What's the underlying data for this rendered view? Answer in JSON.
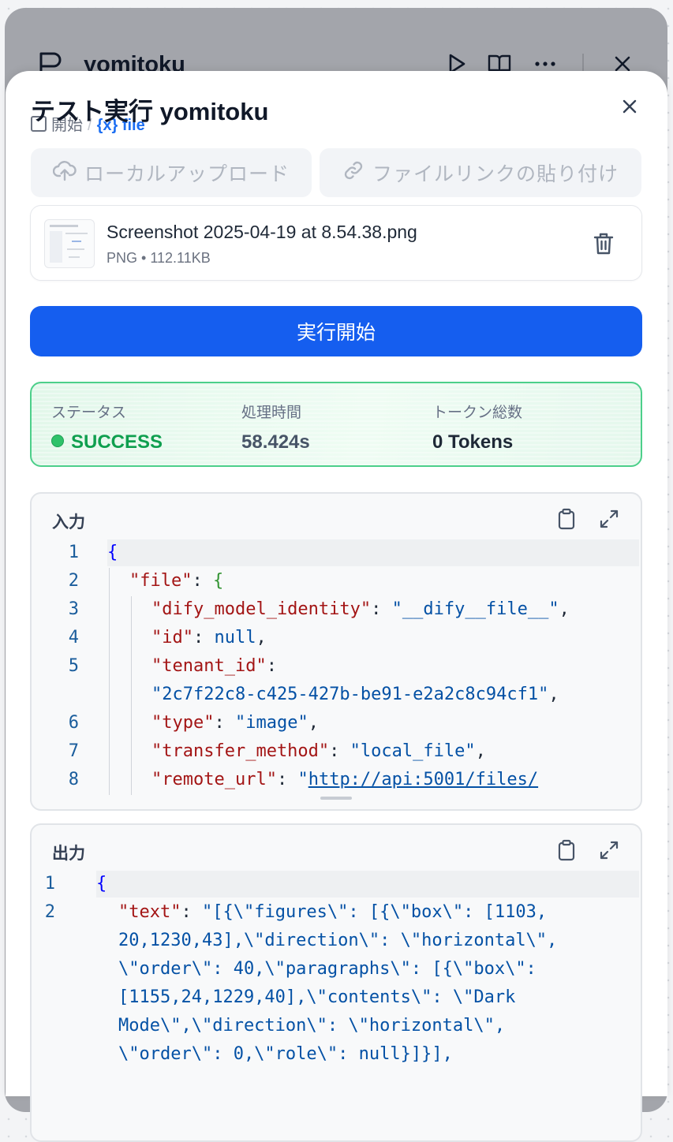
{
  "node": {
    "title": "yomitoku",
    "icons": [
      "flag-icon",
      "play-icon",
      "book-open-icon",
      "more-icon",
      "close-icon"
    ]
  },
  "panel": {
    "title": "テスト実行 yomitoku",
    "breadcrumb": {
      "start": "開始",
      "separator": "/",
      "variable": "file"
    }
  },
  "upload": {
    "local_label": "ローカルアップロード",
    "link_label": "ファイルリンクの貼り付け"
  },
  "file": {
    "name": "Screenshot 2025-04-19 at 8.54.38.png",
    "type": "PNG",
    "dot": "•",
    "size": "112.11KB"
  },
  "run_button": "実行開始",
  "status": {
    "status_label": "ステータス",
    "status_value": "SUCCESS",
    "time_label": "処理時間",
    "time_value": "58.424s",
    "tokens_label": "トークン総数",
    "tokens_value": "0 Tokens",
    "accent": "#0f9f4f"
  },
  "input": {
    "title": "入力",
    "line_numbers": [
      "1",
      "2",
      "3",
      "4",
      "5",
      "",
      "6",
      "7",
      "8"
    ],
    "lines": {
      "l1": "{",
      "l2k": "\"file\"",
      "l2b": ": ",
      "l2c": "{",
      "l3k": "\"dify_model_identity\"",
      "l3v": "\"__dify__file__\"",
      "l4k": "\"id\"",
      "l4v": "null",
      "l5k": "\"tenant_id\"",
      "l5v": "\"2c7f22c8-c425-427b-be91-e2a2c8c94cf1\"",
      "l6k": "\"type\"",
      "l6v": "\"image\"",
      "l7k": "\"transfer_method\"",
      "l7v": "\"local_file\"",
      "l8k": "\"remote_url\"",
      "l8q": "\"",
      "l8v": "http://api:5001/files/"
    }
  },
  "output": {
    "title": "出力",
    "line_numbers": [
      "1",
      "2"
    ],
    "lines": {
      "l1": "{",
      "l2k": "\"text\"",
      "w1": "\"[{\\\"figures\\\": [{\\\"box\\\": [1103,",
      "w2": "20,1230,43],\\\"direction\\\": \\\"horizontal\\\",",
      "w3": "\\\"order\\\": 40,\\\"paragraphs\\\": [{\\\"box\\\":",
      "w4": "[1155,24,1229,40],\\\"contents\\\": \\\"Dark",
      "w5": "Mode\\\",\\\"direction\\\": \\\"horizontal\\\",",
      "w6": "\\\"order\\\": 0,\\\"role\\\": null}]}],"
    }
  }
}
